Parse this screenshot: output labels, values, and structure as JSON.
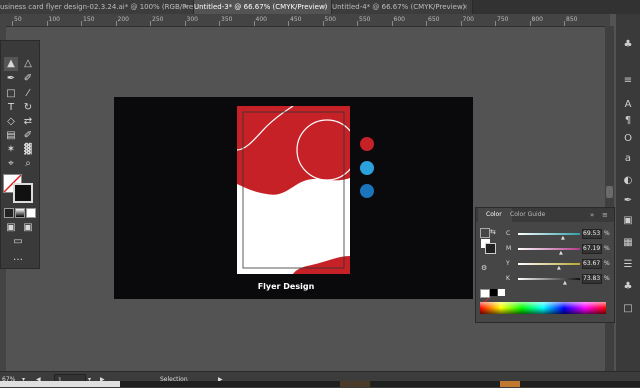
{
  "tabs": [
    {
      "label": "usiness card flyer design-02.3.24.ai* @ 100% (RGB/Preview)",
      "active": false
    },
    {
      "label": "Untitled-3* @ 66.67% (CMYK/Preview)",
      "active": true
    },
    {
      "label": "Untitled-4* @ 66.67% (CMYK/Preview)",
      "active": false
    }
  ],
  "ruler": [
    "50",
    "100",
    "150",
    "200",
    "250",
    "300",
    "350",
    "400",
    "450",
    "500",
    "550",
    "600",
    "650",
    "700",
    "750",
    "800",
    "850"
  ],
  "flyer": {
    "title": "Flyer Design"
  },
  "dots": [
    {
      "color": "#c62127"
    },
    {
      "color": "#2aa3dd"
    },
    {
      "color": "#1b75bc"
    }
  ],
  "color_panel": {
    "tabs": [
      "Color",
      "Color Guide"
    ],
    "channels": [
      {
        "label": "C",
        "value": "69.53",
        "unit": "%",
        "level": 0.6953,
        "color": "#2fa0a8"
      },
      {
        "label": "M",
        "value": "67.19",
        "unit": "%",
        "level": 0.6719,
        "color": "#b03a8a"
      },
      {
        "label": "Y",
        "value": "63.67",
        "unit": "%",
        "level": 0.6367,
        "color": "#b6aa33"
      },
      {
        "label": "K",
        "value": "73.83",
        "unit": "%",
        "level": 0.7383,
        "color": "#888888"
      }
    ]
  },
  "status": {
    "zoom": "67%",
    "page": "1",
    "tool": "Selection"
  },
  "colors": {
    "accent": "#c62127",
    "artboard": "#0a0a0c"
  }
}
